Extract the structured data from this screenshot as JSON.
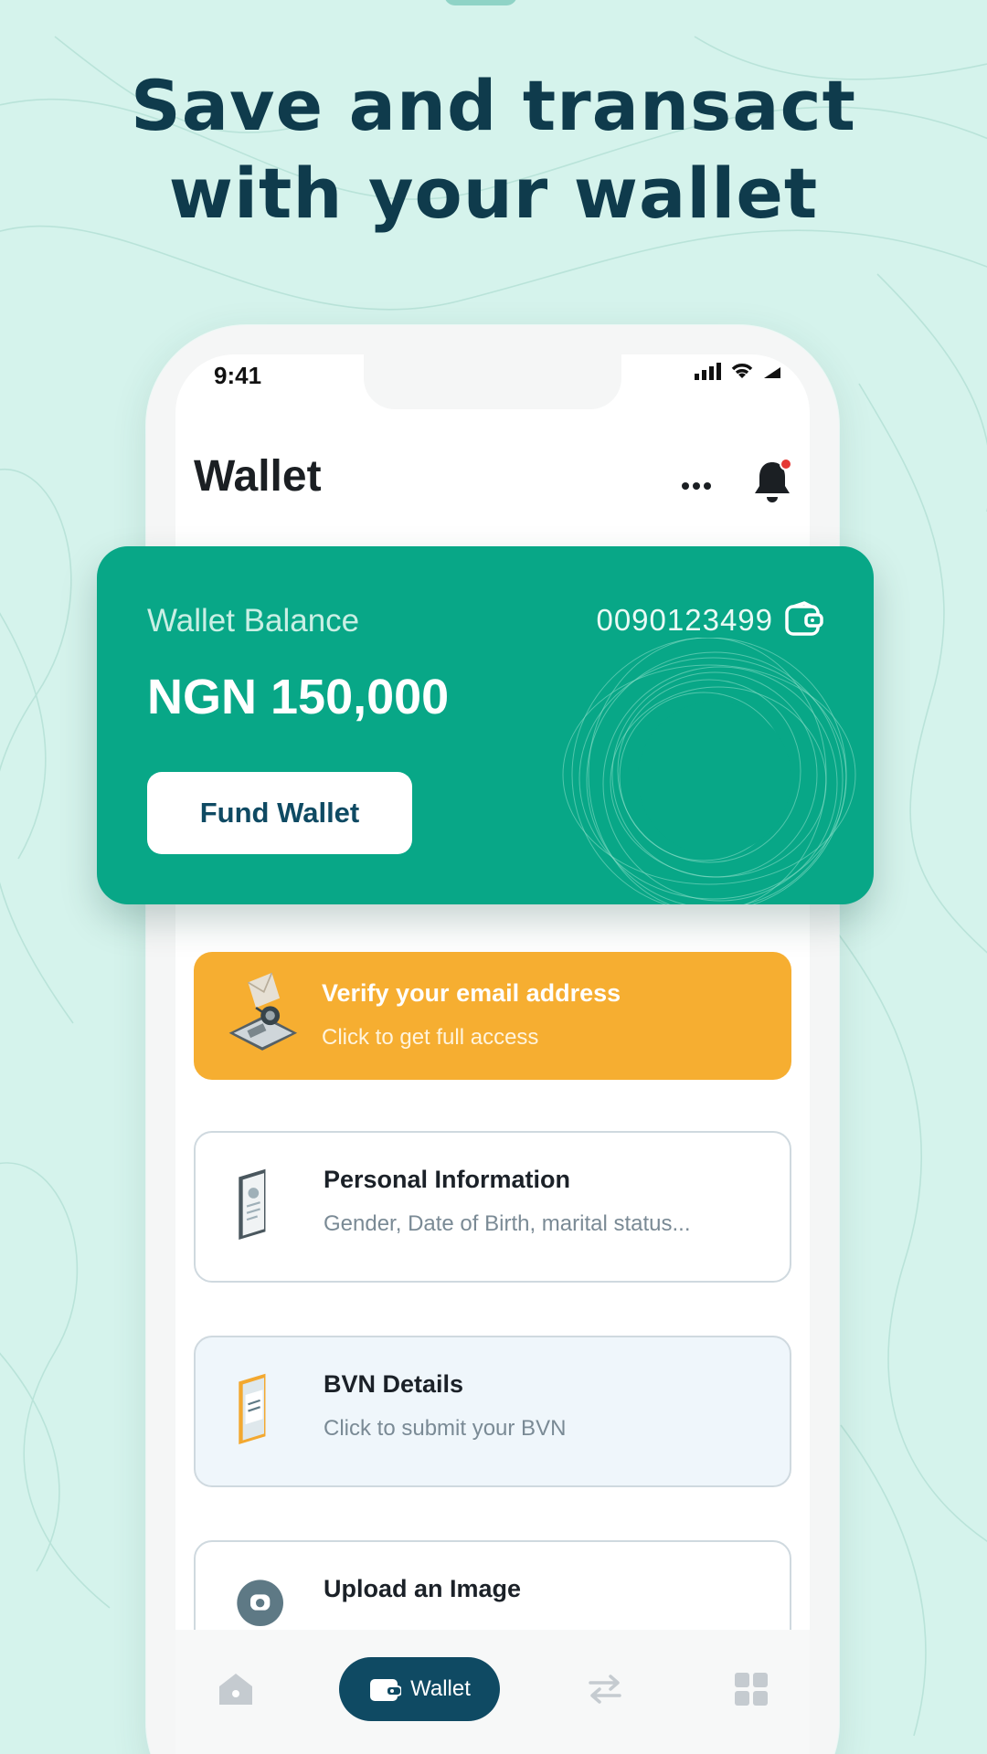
{
  "headline": {
    "line1": "Save and transact",
    "line2": "with your wallet"
  },
  "status_bar": {
    "time": "9:41"
  },
  "page": {
    "title": "Wallet"
  },
  "balance_card": {
    "label": "Wallet Balance",
    "account_number": "0090123499",
    "amount": "NGN 150,000",
    "fund_button": "Fund Wallet"
  },
  "cards": {
    "email": {
      "title": "Verify your email address",
      "subtitle": "Click to get full access"
    },
    "personal": {
      "title": "Personal Information",
      "subtitle": "Gender, Date of Birth, marital status..."
    },
    "bvn": {
      "title": "BVN Details",
      "subtitle": "Click to submit your BVN"
    },
    "upload": {
      "title": "Upload an Image"
    }
  },
  "bottom_nav": {
    "home_icon": "home-icon",
    "wallet_label": "Wallet",
    "transfer_icon": "transfer-icon",
    "more_icon": "grid-icon"
  },
  "colors": {
    "background": "#d5f3ec",
    "headline": "#0f3b4c",
    "card_green": "#08a787",
    "email_card": "#f6ae31",
    "nav_active": "#0f4a63",
    "notification_dot": "#e53935"
  }
}
